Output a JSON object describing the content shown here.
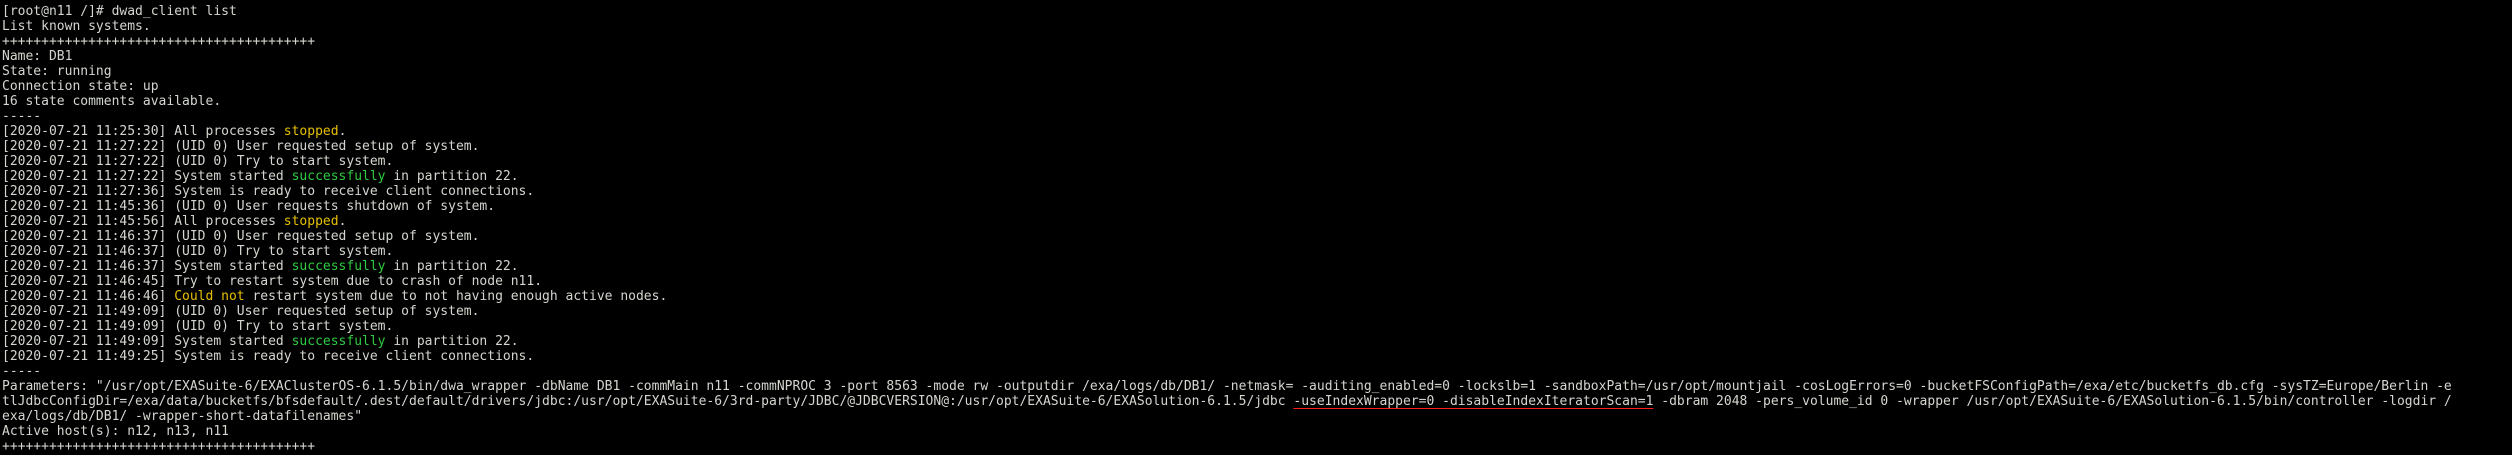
{
  "terminal": {
    "prompt": "[root@n11 /]# ",
    "command": "dwad_client list",
    "header": "List known systems.",
    "separator": "++++++++++++++++++++++++++++++++++++++++",
    "name_line": "Name: DB1",
    "state_line": "State: running",
    "connection_line": "Connection state: up",
    "comments_line": "16 state comments available.",
    "dashes": "-----",
    "log_entries": [
      {
        "ts": "[2020-07-21 11:25:30] ",
        "pre": "All processes ",
        "hl": "stopped",
        "post": ".",
        "color": "yellow"
      },
      {
        "ts": "[2020-07-21 11:27:22] ",
        "pre": "(UID 0) User requested setup of system.",
        "hl": "",
        "post": "",
        "color": ""
      },
      {
        "ts": "[2020-07-21 11:27:22] ",
        "pre": "(UID 0) Try to start system.",
        "hl": "",
        "post": "",
        "color": ""
      },
      {
        "ts": "[2020-07-21 11:27:22] ",
        "pre": "System started ",
        "hl": "successfully",
        "post": " in partition 22.",
        "color": "green"
      },
      {
        "ts": "[2020-07-21 11:27:36] ",
        "pre": "System is ready to receive client connections.",
        "hl": "",
        "post": "",
        "color": ""
      },
      {
        "ts": "[2020-07-21 11:45:36] ",
        "pre": "(UID 0) User requests shutdown of system.",
        "hl": "",
        "post": "",
        "color": ""
      },
      {
        "ts": "[2020-07-21 11:45:56] ",
        "pre": "All processes ",
        "hl": "stopped",
        "post": ".",
        "color": "yellow"
      },
      {
        "ts": "[2020-07-21 11:46:37] ",
        "pre": "(UID 0) User requested setup of system.",
        "hl": "",
        "post": "",
        "color": ""
      },
      {
        "ts": "[2020-07-21 11:46:37] ",
        "pre": "(UID 0) Try to start system.",
        "hl": "",
        "post": "",
        "color": ""
      },
      {
        "ts": "[2020-07-21 11:46:37] ",
        "pre": "System started ",
        "hl": "successfully",
        "post": " in partition 22.",
        "color": "green"
      },
      {
        "ts": "[2020-07-21 11:46:45] ",
        "pre": "Try to restart system due to crash of node n11.",
        "hl": "",
        "post": "",
        "color": ""
      },
      {
        "ts": "[2020-07-21 11:46:46] ",
        "pre": "",
        "hl": "Could not",
        "post": " restart system due to not having enough active nodes.",
        "color": "yellow"
      },
      {
        "ts": "[2020-07-21 11:49:09] ",
        "pre": "(UID 0) User requested setup of system.",
        "hl": "",
        "post": "",
        "color": ""
      },
      {
        "ts": "[2020-07-21 11:49:09] ",
        "pre": "(UID 0) Try to start system.",
        "hl": "",
        "post": "",
        "color": ""
      },
      {
        "ts": "[2020-07-21 11:49:09] ",
        "pre": "System started ",
        "hl": "successfully",
        "post": " in partition 22.",
        "color": "green"
      },
      {
        "ts": "[2020-07-21 11:49:25] ",
        "pre": "System is ready to receive client connections.",
        "hl": "",
        "post": "",
        "color": ""
      }
    ],
    "dashes2": "-----",
    "params_line1": "Parameters: \"/usr/opt/EXASuite-6/EXAClusterOS-6.1.5/bin/dwa_wrapper -dbName DB1 -commMain n11 -commNPROC 3 -port 8563 -mode rw -outputdir /exa/logs/db/DB1/ -netmask= -auditing_enabled=0 -lockslb=1 -sandboxPath=/usr/opt/mountjail -cosLogErrors=0 -bucketFSConfigPath=/exa/etc/bucketfs_db.cfg -sysTZ=Europe/Berlin -e",
    "params_line2_pre": "tlJdbcConfigDir=/exa/data/bucketfs/bfsdefault/.dest/default/drivers/jdbc:/usr/opt/EXASuite-6/3rd-party/JDBC/@JDBCVERSION@:/usr/opt/EXASuite-6/EXASolution-6.1.5/jdbc ",
    "params_line2_hl": "-useIndexWrapper=0 -disableIndexIteratorScan=1",
    "params_line2_post": " -dbram 2048 -pers_volume_id 0 -wrapper /usr/opt/EXASuite-6/EXASolution-6.1.5/bin/controller -logdir /",
    "params_line3": "exa/logs/db/DB1/ -wrapper-short-datafilenames\"",
    "active_hosts": "Active host(s): n12, n13, n11",
    "separator2": "++++++++++++++++++++++++++++++++++++++++",
    "colors": {
      "background": "#000000",
      "text": "#d3d7cf",
      "yellow": "#e6c000",
      "green": "#2ecc40",
      "underline": "#ff1f1f"
    }
  }
}
